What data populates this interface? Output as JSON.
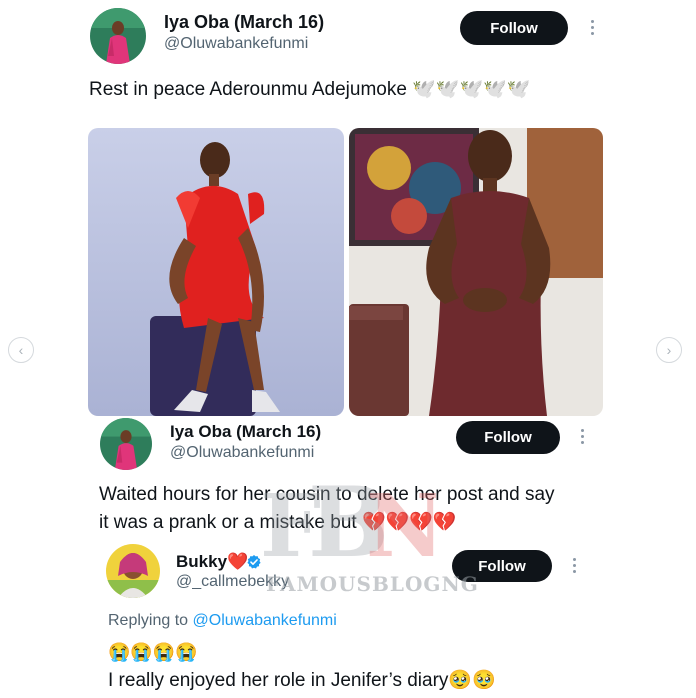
{
  "tweet1": {
    "name": "Iya Oba (March 16)",
    "handle": "@Oluwabankefunmi",
    "follow_label": "Follow",
    "text": "Rest in peace Aderounmu Adejumoke 🕊️🕊️🕊️🕊️🕊️"
  },
  "tweet2": {
    "name": "Iya Oba (March 16)",
    "handle": "@Oluwabankefunmi",
    "follow_label": "Follow",
    "text_line1": "Waited hours for her cousin to delete her post and say",
    "text_line2": "it was a prank or a mistake but 💔💔💔💔"
  },
  "tweet3": {
    "name": "Bukky❤️",
    "handle": "@_callmebekky",
    "follow_label": "Follow",
    "replying_prefix": "Replying to",
    "replying_to": "@Oluwabankefunmi",
    "emoji_line": "😭😭😭😭",
    "text": "I really enjoyed her role in Jenifer’s diary🥹🥹"
  },
  "watermark": {
    "text": "FAMOUSBLOGNG"
  },
  "colors": {
    "follow_bg": "#0f1419",
    "handle": "#536471",
    "mention": "#1d9bf0",
    "verified": "#1d9bf0"
  },
  "icons": {
    "more": "kebab-icon",
    "prev": "chevron-left-icon",
    "next": "chevron-right-icon",
    "verified": "verified-badge-icon"
  }
}
